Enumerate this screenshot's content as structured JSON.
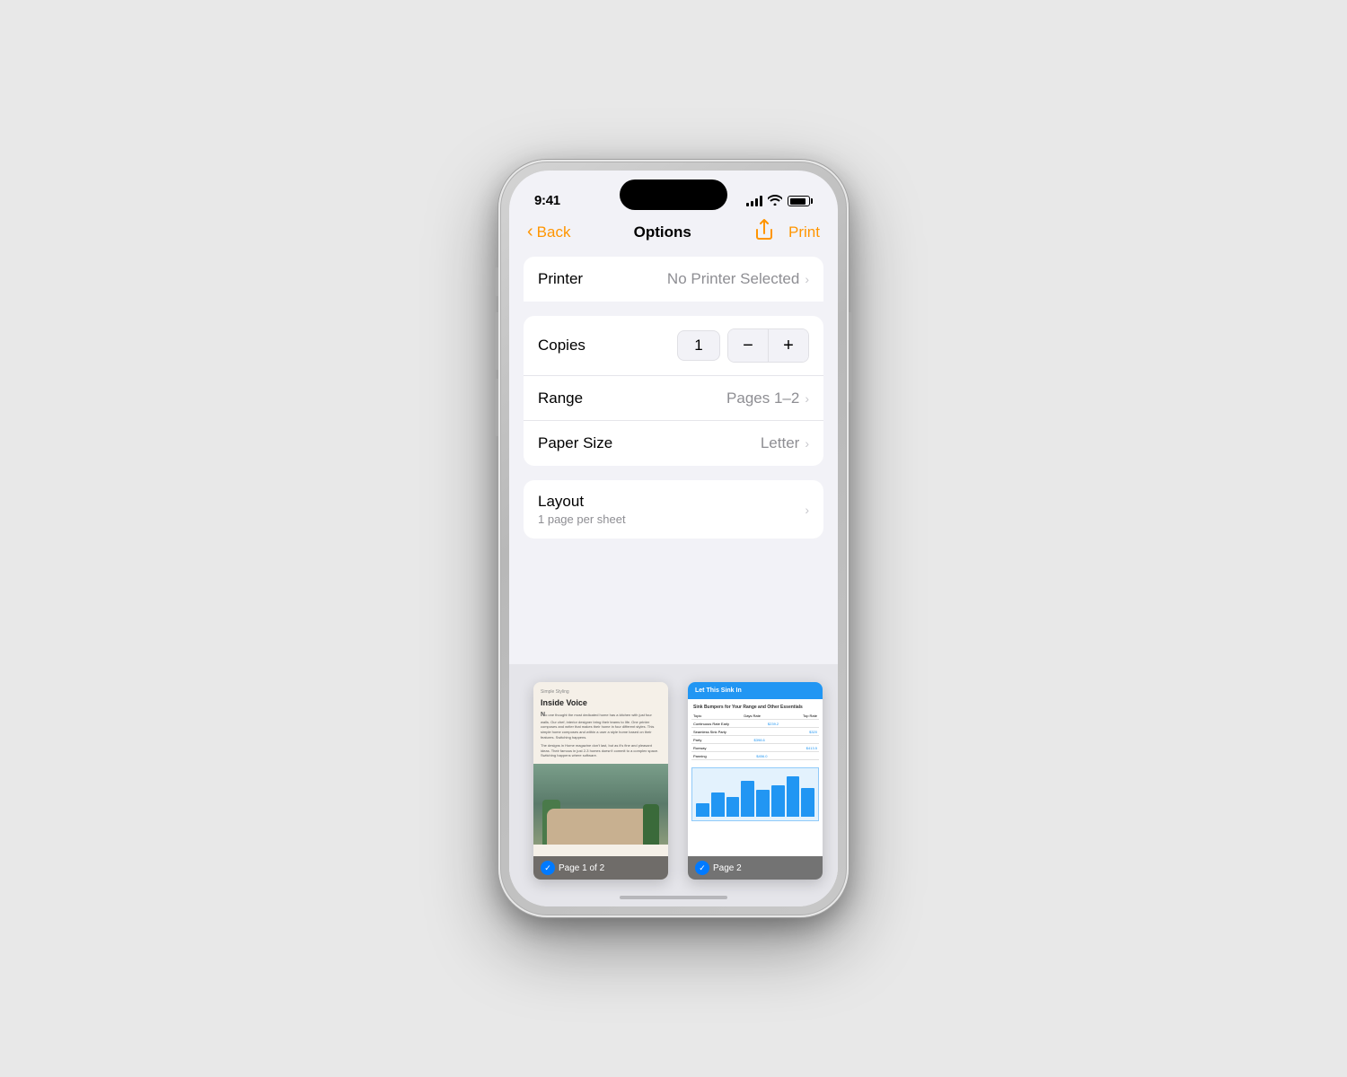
{
  "phone": {
    "status_bar": {
      "time": "9:41"
    },
    "nav": {
      "back_label": "Back",
      "title": "Options",
      "print_label": "Print"
    },
    "printer_section": {
      "label": "Printer",
      "value": "No Printer Selected"
    },
    "copies_section": {
      "label": "Copies",
      "count": "1",
      "minus_label": "−",
      "plus_label": "+"
    },
    "range_section": {
      "label": "Range",
      "value": "Pages 1–2"
    },
    "paper_size_section": {
      "label": "Paper Size",
      "value": "Letter"
    },
    "layout_section": {
      "label": "Layout",
      "sublabel": "1 page per sheet"
    },
    "preview": {
      "page1_badge": "Page 1 of 2",
      "page2_badge": "Page 2",
      "page1_header": "Simple Styling",
      "page1_title": "Inside Voice",
      "page2_header": "Let This Sink In"
    }
  }
}
